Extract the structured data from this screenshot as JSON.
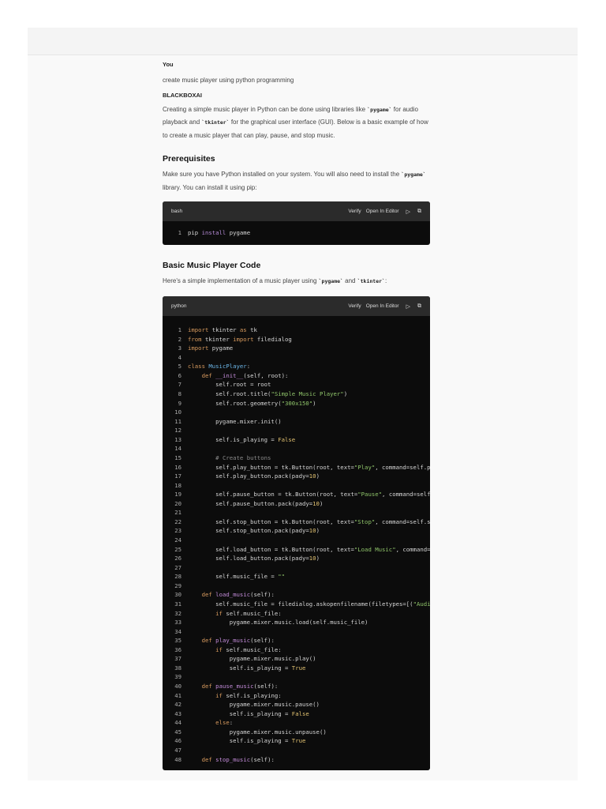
{
  "conversation": {
    "user_label": "You",
    "user_message": "create music player using python programming",
    "assistant_label": "BLACKBOXAI",
    "intro": [
      "Creating a simple music player in Python can be done using libraries like ",
      "`pygame`",
      " for audio playback and ",
      "`tkinter`",
      " for the graphical user interface (GUI). Below is a basic example of how to create a music player that can play, pause, and stop music."
    ],
    "prereq_heading": "Prerequisites",
    "prereq_text": [
      "Make sure you have Python installed on your system. You will also need to install the ",
      "`pygame`",
      " library. You can install it using pip:"
    ],
    "code_heading": "Basic Music Player Code",
    "code_intro": [
      "Here's a simple implementation of a music player using ",
      "`pygame`",
      " and ",
      "`tkinter`",
      ":"
    ]
  },
  "code_actions": {
    "verify": "Verify",
    "open_in_editor": "Open In Editor",
    "run_icon": "play-icon",
    "copy_icon": "copy-icon"
  },
  "bash_block": {
    "language": "bash",
    "lines": [
      [
        [
          "pip ",
          ""
        ],
        [
          "install",
          "b"
        ],
        [
          " pygame",
          ""
        ]
      ]
    ]
  },
  "python_block": {
    "language": "python",
    "lines": [
      [
        [
          "import",
          "k"
        ],
        [
          " tkinter ",
          ""
        ],
        [
          "as",
          "k"
        ],
        [
          " tk",
          ""
        ]
      ],
      [
        [
          "from",
          "k"
        ],
        [
          " tkinter ",
          ""
        ],
        [
          "import",
          "k"
        ],
        [
          " filedialog",
          ""
        ]
      ],
      [
        [
          "import",
          "k"
        ],
        [
          " pygame",
          ""
        ]
      ],
      [],
      [
        [
          "class",
          "k"
        ],
        [
          " ",
          ""
        ],
        [
          "MusicPlayer",
          "c"
        ],
        [
          ":",
          ""
        ]
      ],
      [
        [
          "    ",
          ""
        ],
        [
          "def",
          "k"
        ],
        [
          " ",
          ""
        ],
        [
          "__init__",
          "f"
        ],
        [
          "(self, root):",
          ""
        ]
      ],
      [
        [
          "        self.root = root",
          ""
        ]
      ],
      [
        [
          "        self.root.title(",
          ""
        ],
        [
          "\"Simple Music Player\"",
          "s"
        ],
        [
          ")",
          ""
        ]
      ],
      [
        [
          "        self.root.geometry(",
          ""
        ],
        [
          "\"300x150\"",
          "s"
        ],
        [
          ")",
          ""
        ]
      ],
      [],
      [
        [
          "        pygame.mixer.init()",
          ""
        ]
      ],
      [],
      [
        [
          "        self.is_playing = ",
          ""
        ],
        [
          "False",
          "n"
        ]
      ],
      [],
      [
        [
          "        ",
          ""
        ],
        [
          "# Create buttons",
          "cm"
        ]
      ],
      [
        [
          "        self.play_button = tk.Button(root, text=",
          ""
        ],
        [
          "\"Play\"",
          "s"
        ],
        [
          ", command=self.play_music)",
          ""
        ]
      ],
      [
        [
          "        self.play_button.pack(pady=",
          ""
        ],
        [
          "10",
          "n"
        ],
        [
          ")",
          ""
        ]
      ],
      [],
      [
        [
          "        self.pause_button = tk.Button(root, text=",
          ""
        ],
        [
          "\"Pause\"",
          "s"
        ],
        [
          ", command=self.pause_music)",
          ""
        ]
      ],
      [
        [
          "        self.pause_button.pack(pady=",
          ""
        ],
        [
          "10",
          "n"
        ],
        [
          ")",
          ""
        ]
      ],
      [],
      [
        [
          "        self.stop_button = tk.Button(root, text=",
          ""
        ],
        [
          "\"Stop\"",
          "s"
        ],
        [
          ", command=self.stop_music)",
          ""
        ]
      ],
      [
        [
          "        self.stop_button.pack(pady=",
          ""
        ],
        [
          "10",
          "n"
        ],
        [
          ")",
          ""
        ]
      ],
      [],
      [
        [
          "        self.load_button = tk.Button(root, text=",
          ""
        ],
        [
          "\"Load Music\"",
          "s"
        ],
        [
          ", command=self.load_music)",
          ""
        ]
      ],
      [
        [
          "        self.load_button.pack(pady=",
          ""
        ],
        [
          "10",
          "n"
        ],
        [
          ")",
          ""
        ]
      ],
      [],
      [
        [
          "        self.music_file = ",
          ""
        ],
        [
          "\"\"",
          "s"
        ]
      ],
      [],
      [
        [
          "    ",
          ""
        ],
        [
          "def",
          "k"
        ],
        [
          " ",
          ""
        ],
        [
          "load_music",
          "f"
        ],
        [
          "(self):",
          ""
        ]
      ],
      [
        [
          "        self.music_file = filedialog.askopenfilename(filetypes=[(",
          ""
        ],
        [
          "\"Audio Files\"",
          "s"
        ]
      ],
      [
        [
          "        ",
          ""
        ],
        [
          "if",
          "k"
        ],
        [
          " self.music_file:",
          ""
        ]
      ],
      [
        [
          "            pygame.mixer.music.load(self.music_file)",
          ""
        ]
      ],
      [],
      [
        [
          "    ",
          ""
        ],
        [
          "def",
          "k"
        ],
        [
          " ",
          ""
        ],
        [
          "play_music",
          "f"
        ],
        [
          "(self):",
          ""
        ]
      ],
      [
        [
          "        ",
          ""
        ],
        [
          "if",
          "k"
        ],
        [
          " self.music_file:",
          ""
        ]
      ],
      [
        [
          "            pygame.mixer.music.play()",
          ""
        ]
      ],
      [
        [
          "            self.is_playing = ",
          ""
        ],
        [
          "True",
          "n"
        ]
      ],
      [],
      [
        [
          "    ",
          ""
        ],
        [
          "def",
          "k"
        ],
        [
          " ",
          ""
        ],
        [
          "pause_music",
          "f"
        ],
        [
          "(self):",
          ""
        ]
      ],
      [
        [
          "        ",
          ""
        ],
        [
          "if",
          "k"
        ],
        [
          " self.is_playing:",
          ""
        ]
      ],
      [
        [
          "            pygame.mixer.music.pause()",
          ""
        ]
      ],
      [
        [
          "            self.is_playing = ",
          ""
        ],
        [
          "False",
          "n"
        ]
      ],
      [
        [
          "        ",
          ""
        ],
        [
          "else",
          "k"
        ],
        [
          ":",
          ""
        ]
      ],
      [
        [
          "            pygame.mixer.music.unpause()",
          ""
        ]
      ],
      [
        [
          "            self.is_playing = ",
          ""
        ],
        [
          "True",
          "n"
        ]
      ],
      [],
      [
        [
          "    ",
          ""
        ],
        [
          "def",
          "k"
        ],
        [
          " ",
          ""
        ],
        [
          "stop_music",
          "f"
        ],
        [
          "(self):",
          ""
        ]
      ]
    ]
  }
}
